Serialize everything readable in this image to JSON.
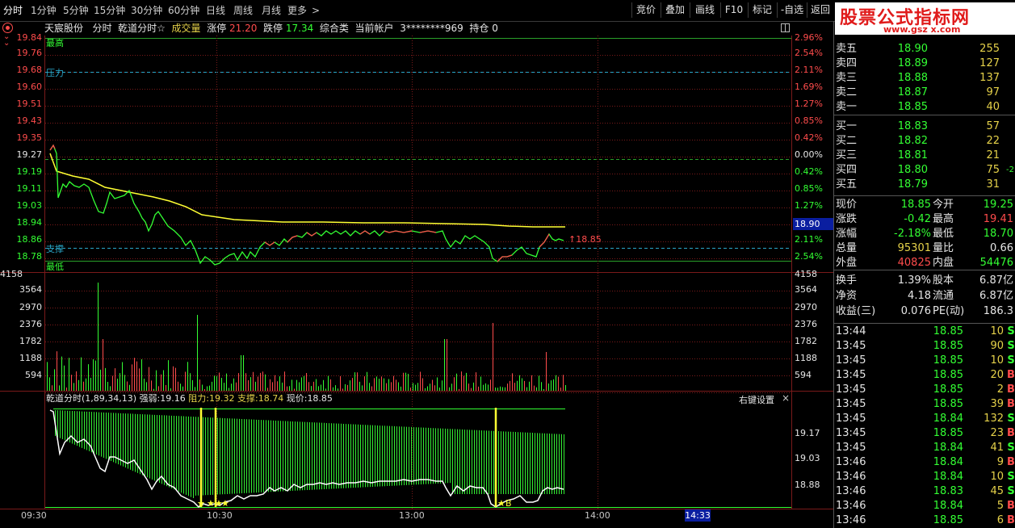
{
  "toolbar": {
    "tabs": [
      "分时",
      "1分钟",
      "5分钟",
      "15分钟",
      "30分钟",
      "60分钟",
      "日线",
      "周线",
      "月线",
      "更多"
    ],
    "more_arrow": ">",
    "right_buttons": [
      "竞价",
      "叠加",
      "画线",
      "F10",
      "标记",
      "-自选",
      "返回"
    ]
  },
  "watermark": {
    "title": "股票公式指标网",
    "url": "www.gsz x.com"
  },
  "info": {
    "stock": "天宸股份",
    "mode": "分时",
    "indicator": "乾道分时☆",
    "vol_label": "成交量",
    "limit_up_label": "涨停",
    "limit_up": "21.20",
    "limit_down_label": "跌停",
    "limit_down": "17.34",
    "category": "综合类",
    "account_label": "当前帐户",
    "account": "3********969",
    "hold_label": "持仓",
    "hold": "0"
  },
  "price_axis": {
    "left": [
      "19.84",
      "19.76",
      "19.68",
      "19.60",
      "19.51",
      "19.43",
      "19.35",
      "19.27",
      "19.19",
      "19.11",
      "19.03",
      "18.94",
      "18.86",
      "18.78"
    ],
    "right": [
      "2.96%",
      "2.54%",
      "2.11%",
      "1.69%",
      "1.27%",
      "0.85%",
      "0.42%",
      "0.00%",
      "0.42%",
      "0.85%",
      "1.27%",
      "1.69%",
      "2.11%",
      "2.54%"
    ],
    "current_tag": "18.90",
    "label_high": "最高",
    "label_pressure": "压力",
    "label_support": "支撑",
    "label_low": "最低",
    "last_price_tag": "↑18.85"
  },
  "volume_axis": {
    "left": [
      "4158",
      "3564",
      "2970",
      "2376",
      "1782",
      "1188",
      "594"
    ],
    "right": [
      "4158",
      "3564",
      "2970",
      "2376",
      "1782",
      "1188",
      "594"
    ]
  },
  "sub": {
    "title": "乾道分时(1,89,34,13)",
    "strong_label": "强弱:",
    "strong": "19.16",
    "resist_label": "阻力:",
    "resist": "19.32",
    "support_label": "支撑:",
    "support": "18.74",
    "price_label": "现价:",
    "price": "18.85",
    "settings": "右键设置",
    "close": "×",
    "axis": [
      "19.17",
      "19.03",
      "18.88"
    ]
  },
  "time_axis": {
    "labels": [
      "09:30",
      "10:30",
      "13:00",
      "14:00"
    ],
    "cursor": "14:33"
  },
  "book": {
    "asks": [
      {
        "label": "卖五",
        "price": "18.90",
        "vol": "255"
      },
      {
        "label": "卖四",
        "price": "18.89",
        "vol": "127"
      },
      {
        "label": "卖三",
        "price": "18.88",
        "vol": "137"
      },
      {
        "label": "卖二",
        "price": "18.87",
        "vol": "97"
      },
      {
        "label": "卖一",
        "price": "18.85",
        "vol": "40"
      }
    ],
    "bids": [
      {
        "label": "买一",
        "price": "18.83",
        "vol": "57",
        "chg": ""
      },
      {
        "label": "买二",
        "price": "18.82",
        "vol": "22",
        "chg": ""
      },
      {
        "label": "买三",
        "price": "18.81",
        "vol": "21",
        "chg": ""
      },
      {
        "label": "买四",
        "price": "18.80",
        "vol": "75",
        "chg": "-2"
      },
      {
        "label": "买五",
        "price": "18.79",
        "vol": "31",
        "chg": ""
      }
    ],
    "quote": [
      {
        "k1": "现价",
        "v1": "18.85",
        "c1": "#33ff33",
        "k2": "今开",
        "v2": "19.25",
        "c2": "#33ff33"
      },
      {
        "k1": "涨跌",
        "v1": "-0.42",
        "c1": "#33ff33",
        "k2": "最高",
        "v2": "19.41",
        "c2": "#ff4c4c"
      },
      {
        "k1": "涨幅",
        "v1": "-2.18%",
        "c1": "#33ff33",
        "k2": "最低",
        "v2": "18.70",
        "c2": "#33ff33"
      },
      {
        "k1": "总量",
        "v1": "95301",
        "c1": "#e6d24a",
        "k2": "量比",
        "v2": "0.66",
        "c2": "#e6e6e6"
      },
      {
        "k1": "外盘",
        "v1": "40825",
        "c1": "#ff4c4c",
        "k2": "内盘",
        "v2": "54476",
        "c2": "#33ff33"
      },
      {
        "k1": "换手",
        "v1": "1.39%",
        "c1": "#e6e6e6",
        "k2": "股本",
        "v2": "6.87亿",
        "c2": "#e6e6e6"
      },
      {
        "k1": "净资",
        "v1": "4.18",
        "c1": "#e6e6e6",
        "k2": "流通",
        "v2": "6.87亿",
        "c2": "#e6e6e6"
      },
      {
        "k1": "收益(三)",
        "v1": "0.076",
        "c1": "#e6e6e6",
        "k2": "PE(动)",
        "v2": "186.3",
        "c2": "#e6e6e6"
      }
    ],
    "trades": [
      {
        "t": "13:44",
        "p": "18.85",
        "v": "10",
        "s": "S"
      },
      {
        "t": "13:45",
        "p": "18.85",
        "v": "90",
        "s": "S"
      },
      {
        "t": "13:45",
        "p": "18.85",
        "v": "10",
        "s": "S"
      },
      {
        "t": "13:45",
        "p": "18.85",
        "v": "20",
        "s": "B"
      },
      {
        "t": "13:45",
        "p": "18.85",
        "v": "2",
        "s": "B"
      },
      {
        "t": "13:45",
        "p": "18.85",
        "v": "39",
        "s": "B"
      },
      {
        "t": "13:45",
        "p": "18.84",
        "v": "132",
        "s": "S"
      },
      {
        "t": "13:45",
        "p": "18.85",
        "v": "23",
        "s": "B"
      },
      {
        "t": "13:45",
        "p": "18.84",
        "v": "41",
        "s": "S"
      },
      {
        "t": "13:46",
        "p": "18.84",
        "v": "9",
        "s": "B"
      },
      {
        "t": "13:46",
        "p": "18.84",
        "v": "10",
        "s": "S"
      },
      {
        "t": "13:46",
        "p": "18.83",
        "v": "45",
        "s": "S"
      },
      {
        "t": "13:46",
        "p": "18.84",
        "v": "5",
        "s": "B"
      },
      {
        "t": "13:46",
        "p": "18.85",
        "v": "6",
        "s": "B"
      }
    ]
  },
  "colors": {
    "up": "#ff4c4c",
    "down": "#33ff33",
    "avg": "#ffff33",
    "grid": "#7a1a1a",
    "support": "#2aa6c8",
    "accent_blue": "#0a1ea0"
  }
}
